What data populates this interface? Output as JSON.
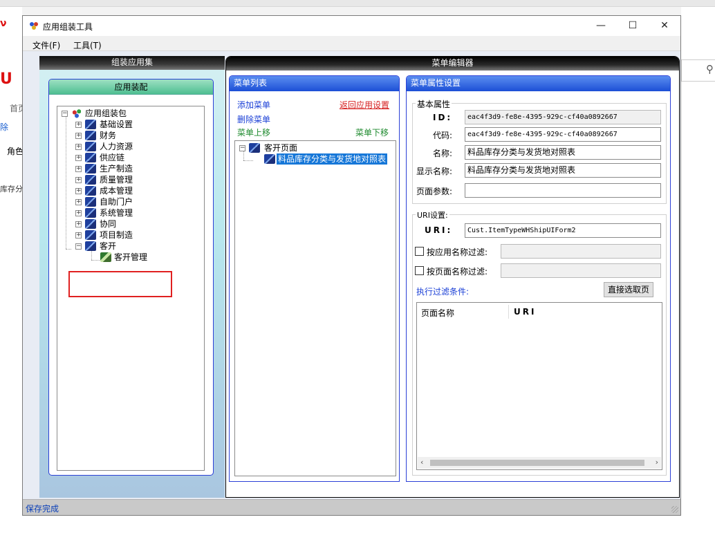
{
  "window": {
    "title": "应用组装工具",
    "minimize_glyph": "—",
    "maximize_glyph": "☐",
    "close_glyph": "✕",
    "icon": "app-assembly-icon"
  },
  "menubar": {
    "file": "文件(F)",
    "tools": "工具(T)"
  },
  "left_pane": {
    "header": "组装应用集",
    "group_title": "应用装配",
    "tree": {
      "root": "应用组装包",
      "items": [
        "基础设置",
        "财务",
        "人力资源",
        "供应链",
        "生产制造",
        "质量管理",
        "成本管理",
        "自助门户",
        "系统管理",
        "协同",
        "项目制造"
      ],
      "expanded_item": "客开",
      "expanded_child": "客开管理"
    }
  },
  "menu_editor": {
    "header": "菜单编辑器",
    "menu_list": {
      "title": "菜单列表",
      "add": "添加菜单",
      "back": "返回应用设置",
      "delete": "删除菜单",
      "move_up": "菜单上移",
      "move_down": "菜单下移",
      "tree_root": "客开页面",
      "tree_child": "料品库存分类与发货地对照表"
    },
    "properties": {
      "title": "菜单属性设置",
      "basic_legend": "基本属性",
      "id_label": "ID:",
      "id_value": "eac4f3d9-fe8e-4395-929c-cf40a0892667",
      "code_label": "代码:",
      "code_value": "eac4f3d9-fe8e-4395-929c-cf40a0892667",
      "name_label": "名称:",
      "name_value": "料品库存分类与发货地对照表",
      "display_label": "显示名称:",
      "display_value": "料品库存分类与发货地对照表",
      "params_label": "页面参数:",
      "params_value": "",
      "uri_legend": "URI设置:",
      "uri_label": "URI:",
      "uri_value": "Cust.ItemTypeWHShipUIForm2",
      "filter_app": "按应用名称过滤:",
      "filter_page": "按页面名称过滤:",
      "exec_filter": "执行过滤条件:",
      "direct_select": "直接选取页",
      "grid_cols": [
        "页面名称",
        "URI"
      ]
    }
  },
  "status": "保存完成",
  "background": {
    "search_icon": "search-icon",
    "frag_home": "首页",
    "frag_role": "角色",
    "frag_stock": "库存分",
    "frag_del": "除"
  }
}
